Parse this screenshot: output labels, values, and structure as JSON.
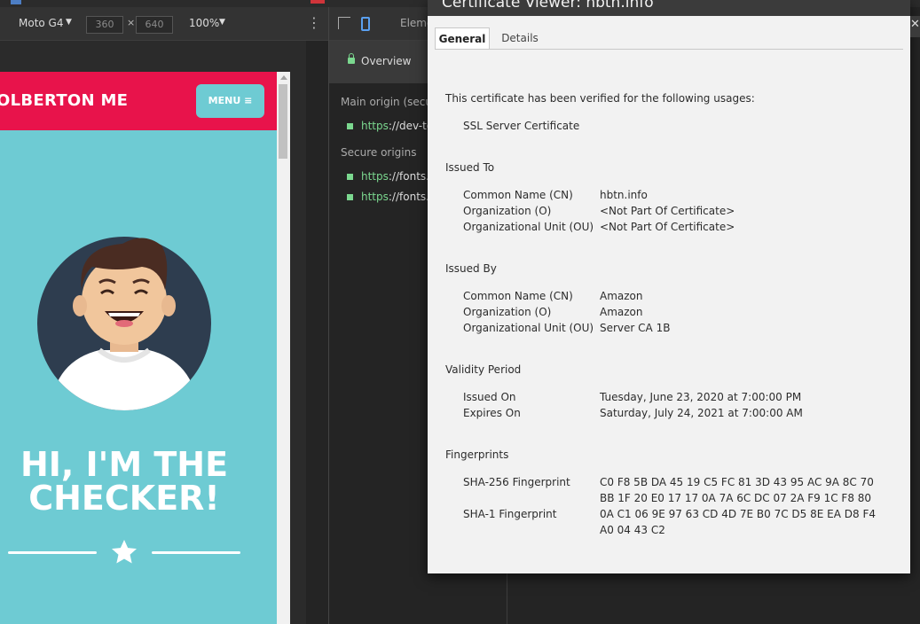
{
  "devtools": {
    "device_name": "Moto G4",
    "width": "360",
    "height": "640",
    "zoom": "100%",
    "elements_tab": "Eleme"
  },
  "page": {
    "logo": "OLBERTON ME",
    "menu_label": "MENU ≡",
    "hero_line1": "HI, I'M THE",
    "hero_line2": "CHECKER!"
  },
  "security": {
    "overview_label": "Overview",
    "main_origin_heading": "Main origin (secure)",
    "main_origin": {
      "scheme": "https",
      "rest": "://dev-to"
    },
    "secure_origins_heading": "Secure origins",
    "secure_origins": [
      {
        "scheme": "https",
        "rest": "://fonts.g"
      },
      {
        "scheme": "https",
        "rest": "://fonts.g"
      }
    ]
  },
  "certificate": {
    "title": "Certificate Viewer: hbtn.info",
    "tabs": [
      "General",
      "Details"
    ],
    "active_tab": "General",
    "verified_text": "This certificate has been verified for the following usages:",
    "usage": "SSL Server Certificate",
    "issued_to": {
      "heading": "Issued To",
      "rows": [
        {
          "label": "Common Name (CN)",
          "value": "hbtn.info"
        },
        {
          "label": "Organization (O)",
          "value": "<Not Part Of Certificate>"
        },
        {
          "label": "Organizational Unit (OU)",
          "value": "<Not Part Of Certificate>"
        }
      ]
    },
    "issued_by": {
      "heading": "Issued By",
      "rows": [
        {
          "label": "Common Name (CN)",
          "value": "Amazon"
        },
        {
          "label": "Organization (O)",
          "value": "Amazon"
        },
        {
          "label": "Organizational Unit (OU)",
          "value": "Server CA 1B"
        }
      ]
    },
    "validity": {
      "heading": "Validity Period",
      "rows": [
        {
          "label": "Issued On",
          "value": "Tuesday, June 23, 2020 at 7:00:00 PM"
        },
        {
          "label": "Expires On",
          "value": "Saturday, July 24, 2021 at 7:00:00 AM"
        }
      ]
    },
    "fingerprints": {
      "heading": "Fingerprints",
      "sha256_label": "SHA-256 Fingerprint",
      "sha256_line1": "C0 F8 5B DA 45 19 C5 FC 81 3D 43 95 AC 9A 8C 70",
      "sha256_line2": "BB 1F 20 E0 17 17 0A 7A 6C DC 07 2A F9 1C F8 80",
      "sha1_label": "SHA-1 Fingerprint",
      "sha1_line1": "0A C1 06 9E 97 63 CD 4D 7E B0 7C D5 8E EA D8 F4",
      "sha1_line2": "A0 04 43 C2"
    }
  },
  "colors": {
    "header_red": "#e8134b",
    "page_teal": "#6ecbd3",
    "secure_green": "#7bd88f",
    "avatar_navy": "#2e3d4f"
  }
}
